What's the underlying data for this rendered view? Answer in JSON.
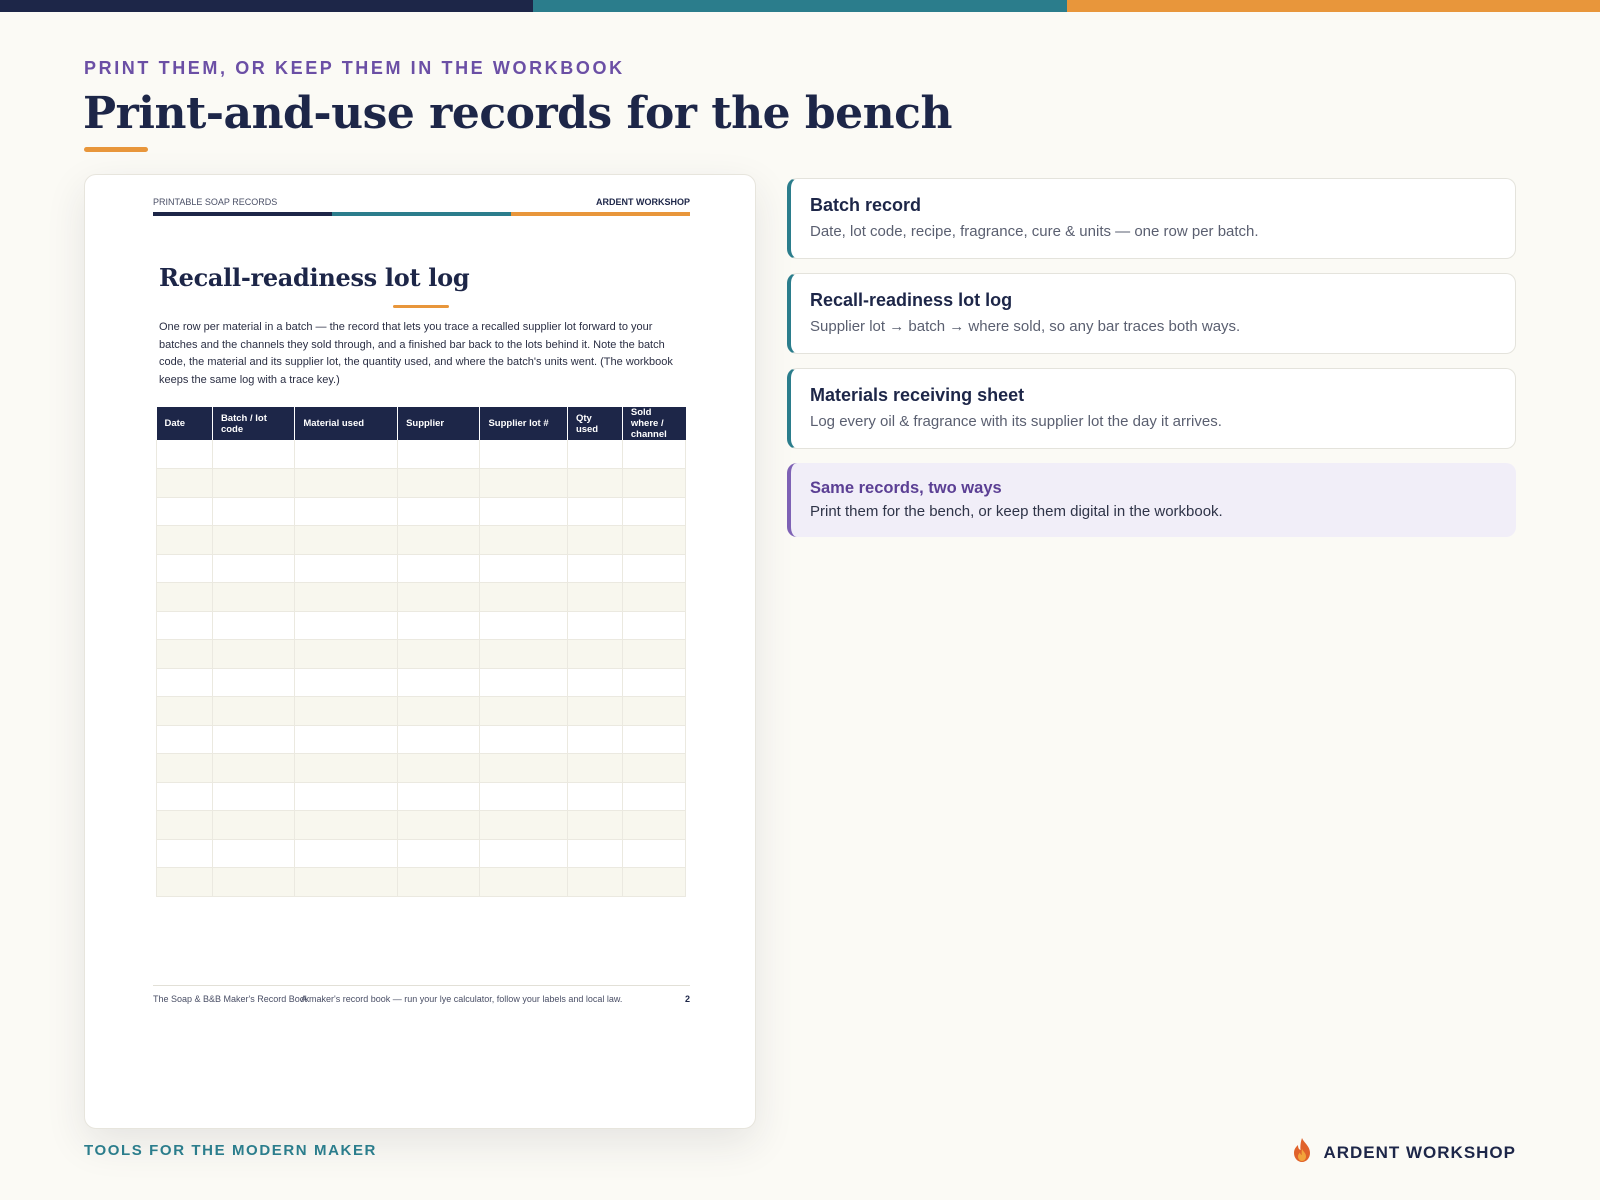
{
  "colors": {
    "navy": "#1d2648",
    "teal": "#2b7d8c",
    "orange": "#e8963b",
    "purple": "#6b4fa5",
    "background": "#fbfaf5"
  },
  "header": {
    "eyebrow": "PRINT THEM, OR KEEP THEM IN THE WORKBOOK",
    "title": "Print-and-use records for the bench"
  },
  "sheet": {
    "header_left": "PRINTABLE SOAP RECORDS",
    "header_right": "ARDENT WORKSHOP",
    "title": "Recall-readiness lot log",
    "body": "One row per material in a batch — the record that lets you trace a recalled supplier lot forward to your batches and the channels they sold through, and a finished bar back to the lots behind it. Note the batch code, the material and its supplier lot, the quantity used, and where the batch's units went. (The workbook keeps the same log with a trace key.)",
    "columns": [
      "Date",
      "Batch / lot code",
      "Material used",
      "Supplier",
      "Supplier lot #",
      "Qty used",
      "Sold where / channel"
    ],
    "blank_rows": 16,
    "footer_left": "The Soap & B&B Maker's Record Book",
    "footer_mid": "A maker's record book — run your lye calculator, follow your labels and local law.",
    "page_number": "2"
  },
  "cards": [
    {
      "title": "Batch record",
      "desc": "Date, lot code, recipe, fragrance, cure & units — one row per batch."
    },
    {
      "title": "Recall-readiness lot log",
      "desc": "Supplier lot → batch → where sold, so any bar traces both ways."
    },
    {
      "title": "Materials receiving sheet",
      "desc": "Log every oil & fragrance with its supplier lot the day it arrives."
    }
  ],
  "note": {
    "title": "Same records, two ways",
    "desc": "Print them for the bench, or keep them digital in the workbook."
  },
  "footer": {
    "tagline": "TOOLS FOR THE MODERN MAKER",
    "brand": "ARDENT WORKSHOP",
    "brand_icon": "flame-icon"
  }
}
